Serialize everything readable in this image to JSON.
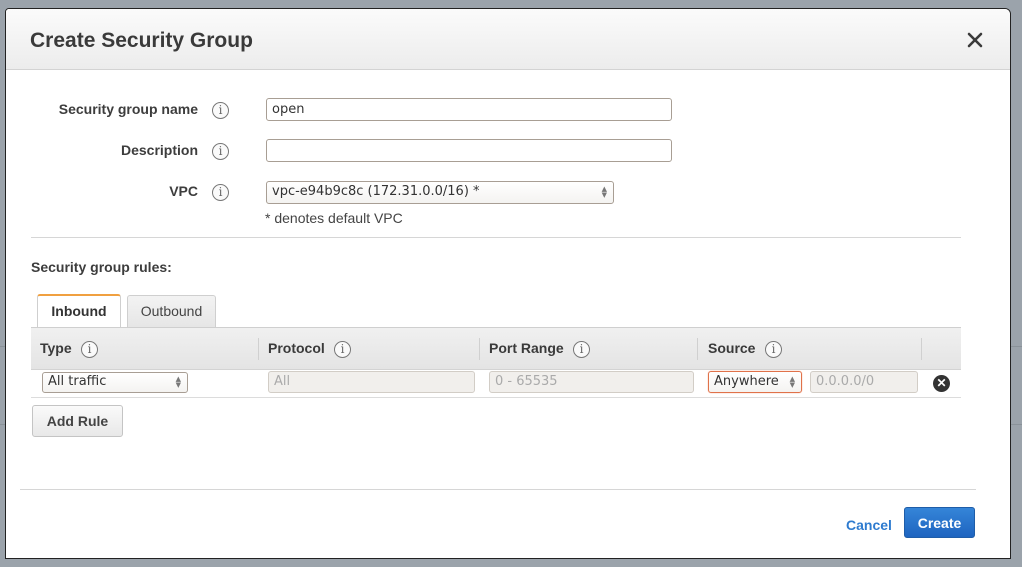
{
  "dialog": {
    "title": "Create Security Group",
    "close_icon": "close-icon"
  },
  "form": {
    "name_label": "Security group name",
    "name_value": "open",
    "description_label": "Description",
    "description_value": "",
    "vpc_label": "VPC",
    "vpc_selected": "vpc-e94b9c8c (172.31.0.0/16) *",
    "vpc_note": "* denotes default VPC",
    "info_glyph": "i"
  },
  "rules": {
    "section_title": "Security group rules:",
    "tabs": [
      {
        "label": "Inbound",
        "active": true
      },
      {
        "label": "Outbound",
        "active": false
      }
    ],
    "columns": [
      {
        "label": "Type"
      },
      {
        "label": "Protocol"
      },
      {
        "label": "Port Range"
      },
      {
        "label": "Source"
      }
    ],
    "rows": [
      {
        "type": "All traffic",
        "protocol": "All",
        "port_range": "0 - 65535",
        "source_type": "Anywhere",
        "source_cidr": "0.0.0.0/0"
      }
    ],
    "add_rule_label": "Add Rule"
  },
  "footer": {
    "cancel_label": "Cancel",
    "create_label": "Create"
  },
  "colors": {
    "primary": "#1e64c0",
    "link": "#2e7bcf",
    "active_tab_accent": "#f0a040",
    "focus_border": "#e0724a"
  }
}
